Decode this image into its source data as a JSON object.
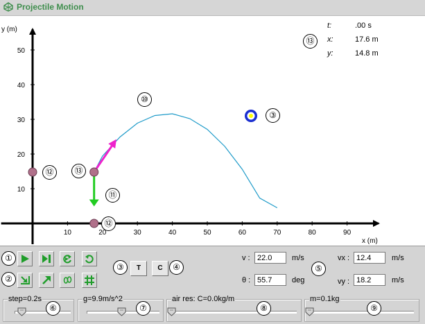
{
  "app": {
    "title": "Projectile Motion"
  },
  "readout": {
    "t_label": "t:",
    "t_value": ".00 s",
    "x_label": "x:",
    "x_value": "17.6 m",
    "y_label": "y:",
    "y_value": "14.8 m"
  },
  "chart_data": {
    "type": "line",
    "xlabel": "x (m)",
    "ylabel": "y (m)",
    "xlim": [
      -9,
      99
    ],
    "ylim": [
      -6,
      56
    ],
    "x_ticks": [
      "10",
      "20",
      "30",
      "40",
      "50",
      "60",
      "70",
      "80",
      "90"
    ],
    "y_ticks": [
      "10",
      "20",
      "30",
      "40",
      "50"
    ],
    "trajectory": {
      "x": [
        17.6,
        20,
        25,
        30,
        35,
        40,
        45,
        50,
        55,
        60,
        65,
        70
      ],
      "y": [
        14.8,
        19.4,
        24.9,
        28.9,
        31.1,
        31.6,
        30.2,
        27.1,
        22.2,
        15.6,
        7.3,
        4.5
      ]
    },
    "projectile": {
      "x": 17.6,
      "y": 14.8
    },
    "target": {
      "x": 62.5,
      "y": 31
    },
    "x_axis_marker": {
      "x": 17.6,
      "y": 0
    },
    "y_axis_marker": {
      "x": 0,
      "y": 14.8
    },
    "velocity_vector": {
      "dx": 12.4,
      "dy": 18.2
    },
    "gravity_vector": {
      "dy": -9.9
    },
    "colors": {
      "trajectory": "#1f9bc9",
      "velocity": "#ee22cc",
      "gravity": "#22cc22",
      "target": "#1b2fd0",
      "target_center": "#ffff00",
      "projectile": "#b0708a"
    }
  },
  "markers": {
    "velocity_vector": "⑩",
    "gravity_vector": "⑪",
    "axis_marker_y": "⑫",
    "axis_marker_x": "⑫",
    "projectile": "⑬",
    "readout": "⑬",
    "target": "③",
    "play": "①",
    "tools": "②",
    "trace_toggle": "③",
    "clear_toggle": "④",
    "inputs": "⑤",
    "step": "⑥",
    "gravity": "⑦",
    "air": "⑧",
    "mass": "⑨"
  },
  "buttons": {
    "play_icon": "play-icon",
    "step_icon": "step-forward-icon",
    "reset_icon": "reset-icon",
    "undo_icon": "undo-icon",
    "zoom_icon": "zoom-icon",
    "vector_icon": "arrow-icon",
    "trail_icon": "footprints-icon",
    "grid_icon": "grid-icon",
    "trace_label": "T",
    "clear_label": "C"
  },
  "inputs": {
    "v_label": "v :",
    "v_value": "22.0",
    "v_unit": "m/s",
    "theta_label": "θ :",
    "theta_value": "55.7",
    "theta_unit": "deg",
    "vx_label": "vx :",
    "vx_value": "12.4",
    "vx_unit": "m/s",
    "vy_label": "vy :",
    "vy_value": "18.2",
    "vy_unit": "m/s"
  },
  "sliders": {
    "step": {
      "label": "step=0.2s",
      "value": 0.2,
      "min": 0.1,
      "max": 1.0
    },
    "gravity": {
      "label": "g=9.9m/s^2",
      "value": 9.9,
      "min": 0,
      "max": 20
    },
    "air": {
      "label": "air res: C=0.0kg/m",
      "value": 0.0,
      "min": 0,
      "max": 1
    },
    "mass": {
      "label": "m=0.1kg",
      "value": 0.1,
      "min": 0.1,
      "max": 10
    }
  }
}
